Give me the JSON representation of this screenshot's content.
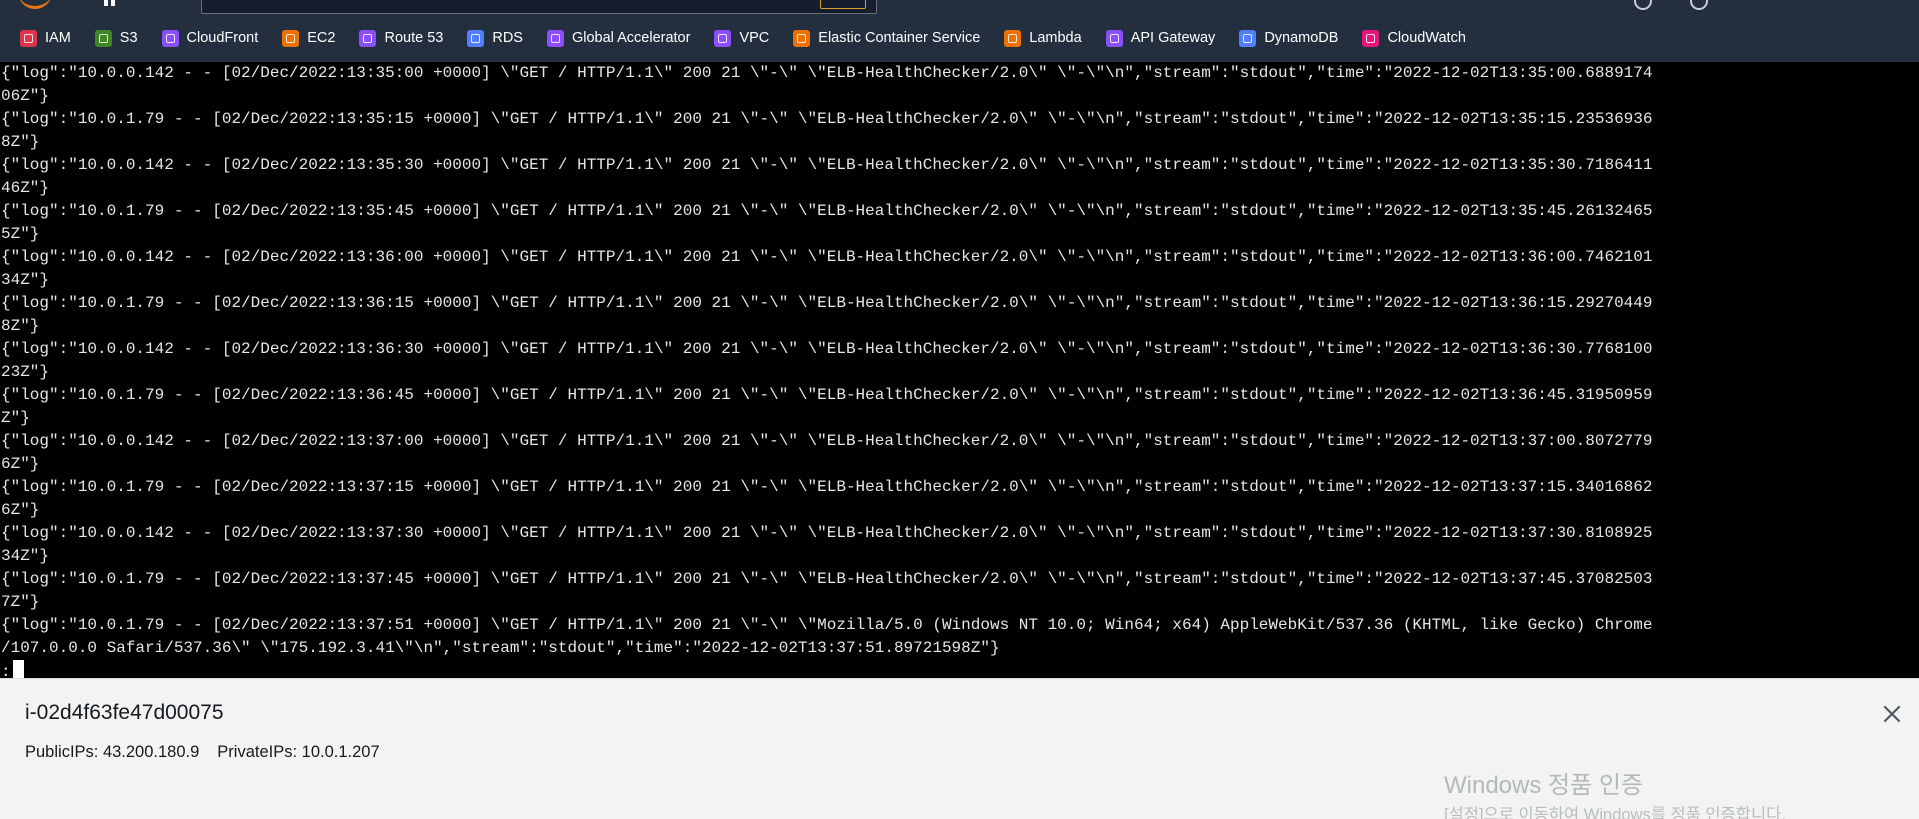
{
  "favorites": [
    {
      "label": "IAM",
      "icon": "iam-icon",
      "color": "#dd344c"
    },
    {
      "label": "S3",
      "icon": "s3-icon",
      "color": "#3f8624"
    },
    {
      "label": "CloudFront",
      "icon": "cloudfront-icon",
      "color": "#8c4fff"
    },
    {
      "label": "EC2",
      "icon": "ec2-icon",
      "color": "#ed7100"
    },
    {
      "label": "Route 53",
      "icon": "route53-icon",
      "color": "#8c4fff"
    },
    {
      "label": "RDS",
      "icon": "rds-icon",
      "color": "#527fff"
    },
    {
      "label": "Global Accelerator",
      "icon": "global-accelerator-icon",
      "color": "#8c4fff"
    },
    {
      "label": "VPC",
      "icon": "vpc-icon",
      "color": "#8c4fff"
    },
    {
      "label": "Elastic Container Service",
      "icon": "ecs-icon",
      "color": "#ed7100"
    },
    {
      "label": "Lambda",
      "icon": "lambda-icon",
      "color": "#ed7100"
    },
    {
      "label": "API Gateway",
      "icon": "api-gateway-icon",
      "color": "#8c4fff"
    },
    {
      "label": "DynamoDB",
      "icon": "dynamodb-icon",
      "color": "#527fff"
    },
    {
      "label": "CloudWatch",
      "icon": "cloudwatch-icon",
      "color": "#e7157b"
    }
  ],
  "terminal": {
    "lines": [
      "{\"log\":\"10.0.0.142 - - [02/Dec/2022:13:35:00 +0000] \\\"GET / HTTP/1.1\\\" 200 21 \\\"-\\\" \\\"ELB-HealthChecker/2.0\\\" \\\"-\\\"\\n\",\"stream\":\"stdout\",\"time\":\"2022-12-02T13:35:00.6889174",
      "06Z\"}",
      "{\"log\":\"10.0.1.79 - - [02/Dec/2022:13:35:15 +0000] \\\"GET / HTTP/1.1\\\" 200 21 \\\"-\\\" \\\"ELB-HealthChecker/2.0\\\" \\\"-\\\"\\n\",\"stream\":\"stdout\",\"time\":\"2022-12-02T13:35:15.23536936",
      "8Z\"}",
      "{\"log\":\"10.0.0.142 - - [02/Dec/2022:13:35:30 +0000] \\\"GET / HTTP/1.1\\\" 200 21 \\\"-\\\" \\\"ELB-HealthChecker/2.0\\\" \\\"-\\\"\\n\",\"stream\":\"stdout\",\"time\":\"2022-12-02T13:35:30.7186411",
      "46Z\"}",
      "{\"log\":\"10.0.1.79 - - [02/Dec/2022:13:35:45 +0000] \\\"GET / HTTP/1.1\\\" 200 21 \\\"-\\\" \\\"ELB-HealthChecker/2.0\\\" \\\"-\\\"\\n\",\"stream\":\"stdout\",\"time\":\"2022-12-02T13:35:45.26132465",
      "5Z\"}",
      "{\"log\":\"10.0.0.142 - - [02/Dec/2022:13:36:00 +0000] \\\"GET / HTTP/1.1\\\" 200 21 \\\"-\\\" \\\"ELB-HealthChecker/2.0\\\" \\\"-\\\"\\n\",\"stream\":\"stdout\",\"time\":\"2022-12-02T13:36:00.7462101",
      "34Z\"}",
      "{\"log\":\"10.0.1.79 - - [02/Dec/2022:13:36:15 +0000] \\\"GET / HTTP/1.1\\\" 200 21 \\\"-\\\" \\\"ELB-HealthChecker/2.0\\\" \\\"-\\\"\\n\",\"stream\":\"stdout\",\"time\":\"2022-12-02T13:36:15.29270449",
      "8Z\"}",
      "{\"log\":\"10.0.0.142 - - [02/Dec/2022:13:36:30 +0000] \\\"GET / HTTP/1.1\\\" 200 21 \\\"-\\\" \\\"ELB-HealthChecker/2.0\\\" \\\"-\\\"\\n\",\"stream\":\"stdout\",\"time\":\"2022-12-02T13:36:30.7768100",
      "23Z\"}",
      "{\"log\":\"10.0.1.79 - - [02/Dec/2022:13:36:45 +0000] \\\"GET / HTTP/1.1\\\" 200 21 \\\"-\\\" \\\"ELB-HealthChecker/2.0\\\" \\\"-\\\"\\n\",\"stream\":\"stdout\",\"time\":\"2022-12-02T13:36:45.31950959",
      "Z\"}",
      "{\"log\":\"10.0.0.142 - - [02/Dec/2022:13:37:00 +0000] \\\"GET / HTTP/1.1\\\" 200 21 \\\"-\\\" \\\"ELB-HealthChecker/2.0\\\" \\\"-\\\"\\n\",\"stream\":\"stdout\",\"time\":\"2022-12-02T13:37:00.8072779",
      "6Z\"}",
      "{\"log\":\"10.0.1.79 - - [02/Dec/2022:13:37:15 +0000] \\\"GET / HTTP/1.1\\\" 200 21 \\\"-\\\" \\\"ELB-HealthChecker/2.0\\\" \\\"-\\\"\\n\",\"stream\":\"stdout\",\"time\":\"2022-12-02T13:37:15.34016862",
      "6Z\"}",
      "{\"log\":\"10.0.0.142 - - [02/Dec/2022:13:37:30 +0000] \\\"GET / HTTP/1.1\\\" 200 21 \\\"-\\\" \\\"ELB-HealthChecker/2.0\\\" \\\"-\\\"\\n\",\"stream\":\"stdout\",\"time\":\"2022-12-02T13:37:30.8108925",
      "34Z\"}",
      "{\"log\":\"10.0.1.79 - - [02/Dec/2022:13:37:45 +0000] \\\"GET / HTTP/1.1\\\" 200 21 \\\"-\\\" \\\"ELB-HealthChecker/2.0\\\" \\\"-\\\"\\n\",\"stream\":\"stdout\",\"time\":\"2022-12-02T13:37:45.37082503",
      "7Z\"}",
      "{\"log\":\"10.0.1.79 - - [02/Dec/2022:13:37:51 +0000] \\\"GET / HTTP/1.1\\\" 200 21 \\\"-\\\" \\\"Mozilla/5.0 (Windows NT 10.0; Win64; x64) AppleWebKit/537.36 (KHTML, like Gecko) Chrome",
      "/107.0.0.0 Safari/537.36\\\" \\\"175.192.3.41\\\"\\n\",\"stream\":\"stdout\",\"time\":\"2022-12-02T13:37:51.89721598Z\"}"
    ],
    "prompt": ":"
  },
  "instance": {
    "id": "i-02d4f63fe47d00075",
    "public_ips": "PublicIPs: 43.200.180.9",
    "private_ips": "PrivateIPs: 10.0.1.207"
  },
  "watermark": {
    "title": "Windows 정품 인증",
    "subtitle": "[설정]으로 이동하여 Windows를 정품 인증합니다."
  }
}
